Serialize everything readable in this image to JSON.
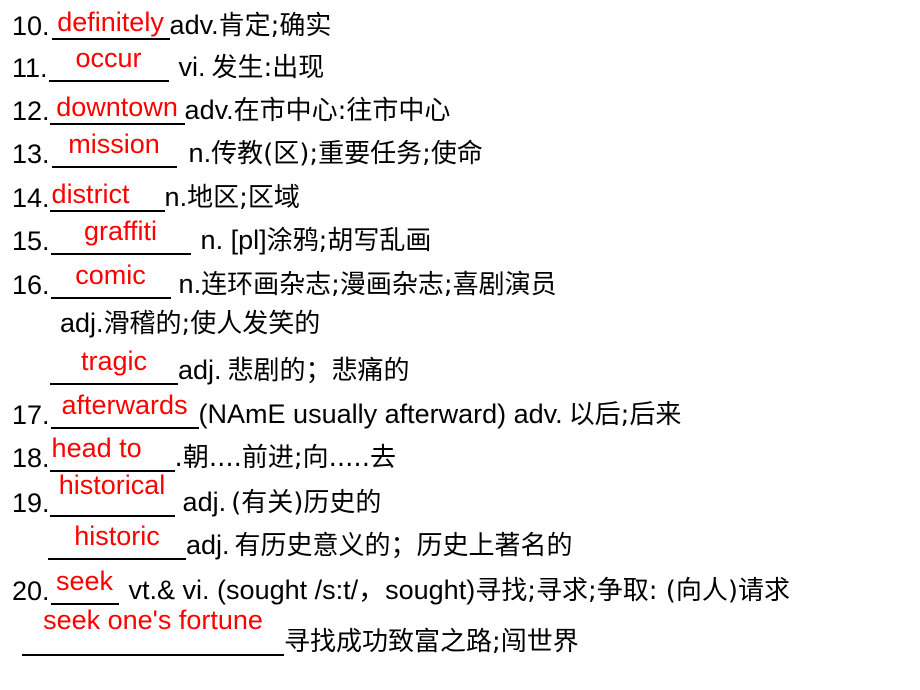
{
  "meta": {
    "slide_kind": "vocabulary-fill-in-the-blank",
    "answer_color": "#ff0000",
    "text_color": "#000000",
    "background_color": "#ffffff"
  },
  "entries": [
    {
      "number": "10.",
      "answer": "definitely",
      "definition": "adv.",
      "chinese": "肯定;确实"
    },
    {
      "number": "11.",
      "answer": "occur",
      "definition": "vi.",
      "chinese": "发生:出现"
    },
    {
      "number": "12.",
      "answer": "downtown",
      "definition": "adv.",
      "chinese": "在市中心:往市中心"
    },
    {
      "number": "13.",
      "answer": "mission",
      "definition": "n.",
      "chinese": "传教(区);重要任务;使命"
    },
    {
      "number": "14.",
      "answer": "district",
      "definition": "n.",
      "chinese": "地区;区域"
    },
    {
      "number": "15.",
      "answer": "graffiti",
      "definition": "n. [pl]",
      "chinese": "涂鸦;胡写乱画"
    },
    {
      "number": "16.",
      "answer": "comic",
      "definition": "n.",
      "chinese": "连环画杂志;漫画杂志;喜剧演员"
    },
    {
      "number": "17.",
      "answer": "afterwards",
      "definition": "(NAmE usually afterward) adv.",
      "chinese": "以后;后来"
    },
    {
      "number": "18.",
      "answer": "head to",
      "definition": ".",
      "chinese": "朝....前进;向.....去"
    },
    {
      "number": "19.",
      "answer": "historical",
      "definition": "adj.",
      "chinese": "(有关)历史的"
    },
    {
      "number": "20.",
      "answer": "seek",
      "definition": "vt.& vi. (sought /s:t/，sought)",
      "chinese": "寻找;寻求;争取: (向人)请求"
    }
  ],
  "continuations": {
    "comic_adj": {
      "definition": "adj.",
      "chinese": "滑稽的;使人发笑的"
    },
    "tragic": {
      "answer": "tragic",
      "definition": "adj.",
      "chinese": "悲剧的；悲痛的"
    },
    "historic": {
      "answer": "historic",
      "definition": "adj.",
      "chinese": "有历史意义的；历史上著名的"
    },
    "seek_fortune": {
      "answer": "seek one's fortune",
      "chinese": "寻找成功致富之路;闯世界"
    }
  }
}
